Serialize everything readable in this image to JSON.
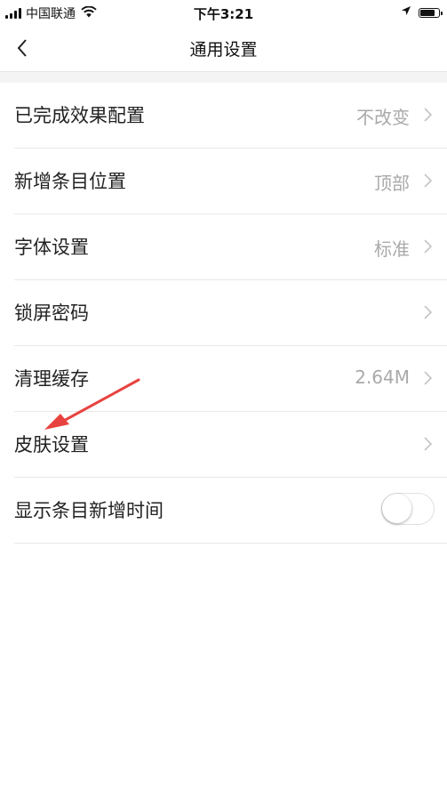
{
  "status_bar": {
    "carrier": "中国联通",
    "time": "下午3:21",
    "battery_level_percent": 85
  },
  "nav": {
    "title": "通用设置",
    "back_icon": "chevron-left-icon"
  },
  "settings": [
    {
      "label": "已完成效果配置",
      "value": "不改变",
      "control": "chevron"
    },
    {
      "label": "新增条目位置",
      "value": "顶部",
      "control": "chevron"
    },
    {
      "label": "字体设置",
      "value": "标准",
      "control": "chevron"
    },
    {
      "label": "锁屏密码",
      "value": "",
      "control": "chevron"
    },
    {
      "label": "清理缓存",
      "value": "2.64M",
      "control": "chevron"
    },
    {
      "label": "皮肤设置",
      "value": "",
      "control": "chevron"
    },
    {
      "label": "显示条目新增时间",
      "control": "toggle",
      "toggle_on": false
    }
  ],
  "annotation": {
    "arrow_color": "#e8423f",
    "points_to": "皮肤设置"
  }
}
